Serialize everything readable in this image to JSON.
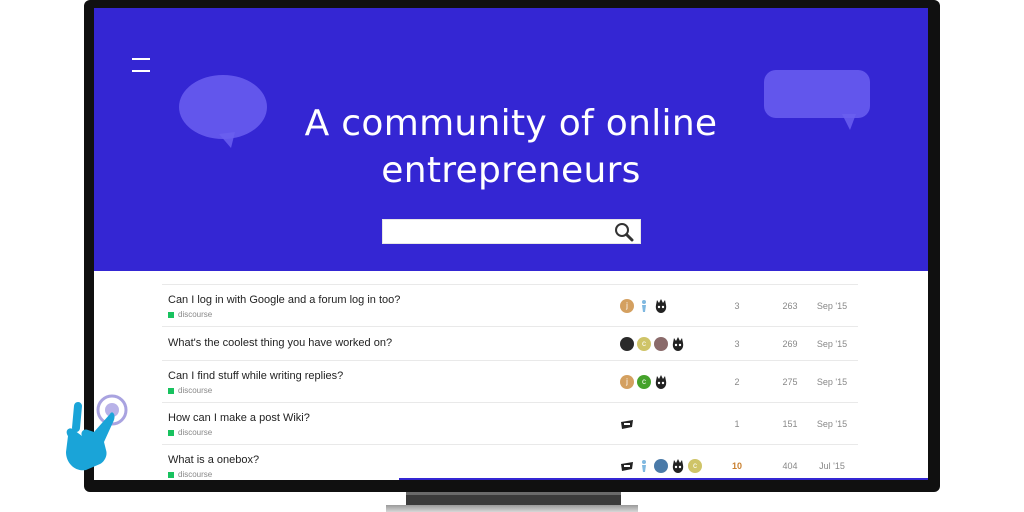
{
  "hero": {
    "title_line1": "A community of online",
    "title_line2": "entrepreneurs",
    "background_color": "#3426d3",
    "search": {
      "value": "",
      "placeholder": ""
    },
    "icons": [
      "menu-icon",
      "speech-bubble-icon",
      "search-icon"
    ]
  },
  "topics": [
    {
      "title": "Can I log in with Google and a forum log in too?",
      "category": "discourse",
      "posters": [
        {
          "letter": "j",
          "color": "#d4a060"
        },
        {
          "letter": "",
          "color": "#7fb8e0",
          "kind": "figure"
        },
        {
          "letter": "",
          "color": "#222222",
          "kind": "spiky"
        }
      ],
      "replies": "3",
      "views": "263",
      "activity": "Sep '15"
    },
    {
      "title": "What's the coolest thing you have worked on?",
      "category": "",
      "posters": [
        {
          "letter": "",
          "color": "#2a2a2a",
          "kind": "photo"
        },
        {
          "letter": "c",
          "color": "#cfc468"
        },
        {
          "letter": "",
          "color": "#8a6a6a",
          "kind": "photo"
        },
        {
          "letter": "",
          "color": "#222222",
          "kind": "spiky"
        }
      ],
      "replies": "3",
      "views": "269",
      "activity": "Sep '15"
    },
    {
      "title": "Can I find stuff while writing replies?",
      "category": "discourse",
      "posters": [
        {
          "letter": "j",
          "color": "#d4a060"
        },
        {
          "letter": "c",
          "color": "#45a22b"
        },
        {
          "letter": "",
          "color": "#222222",
          "kind": "spiky"
        }
      ],
      "replies": "2",
      "views": "275",
      "activity": "Sep '15"
    },
    {
      "title": "How can I make a post Wiki?",
      "category": "discourse",
      "posters": [
        {
          "letter": "",
          "color": "#222222",
          "kind": "ninja"
        }
      ],
      "replies": "1",
      "views": "151",
      "activity": "Sep '15"
    },
    {
      "title": "What is a onebox?",
      "category": "discourse",
      "posters": [
        {
          "letter": "",
          "color": "#222222",
          "kind": "ninja"
        },
        {
          "letter": "",
          "color": "#7fb8e0",
          "kind": "figure"
        },
        {
          "letter": "",
          "color": "#4a7aa8",
          "kind": "photo"
        },
        {
          "letter": "",
          "color": "#222222",
          "kind": "spiky"
        },
        {
          "letter": "c",
          "color": "#cfc468"
        }
      ],
      "replies": "10",
      "views": "404",
      "activity": "Jul '15"
    }
  ]
}
